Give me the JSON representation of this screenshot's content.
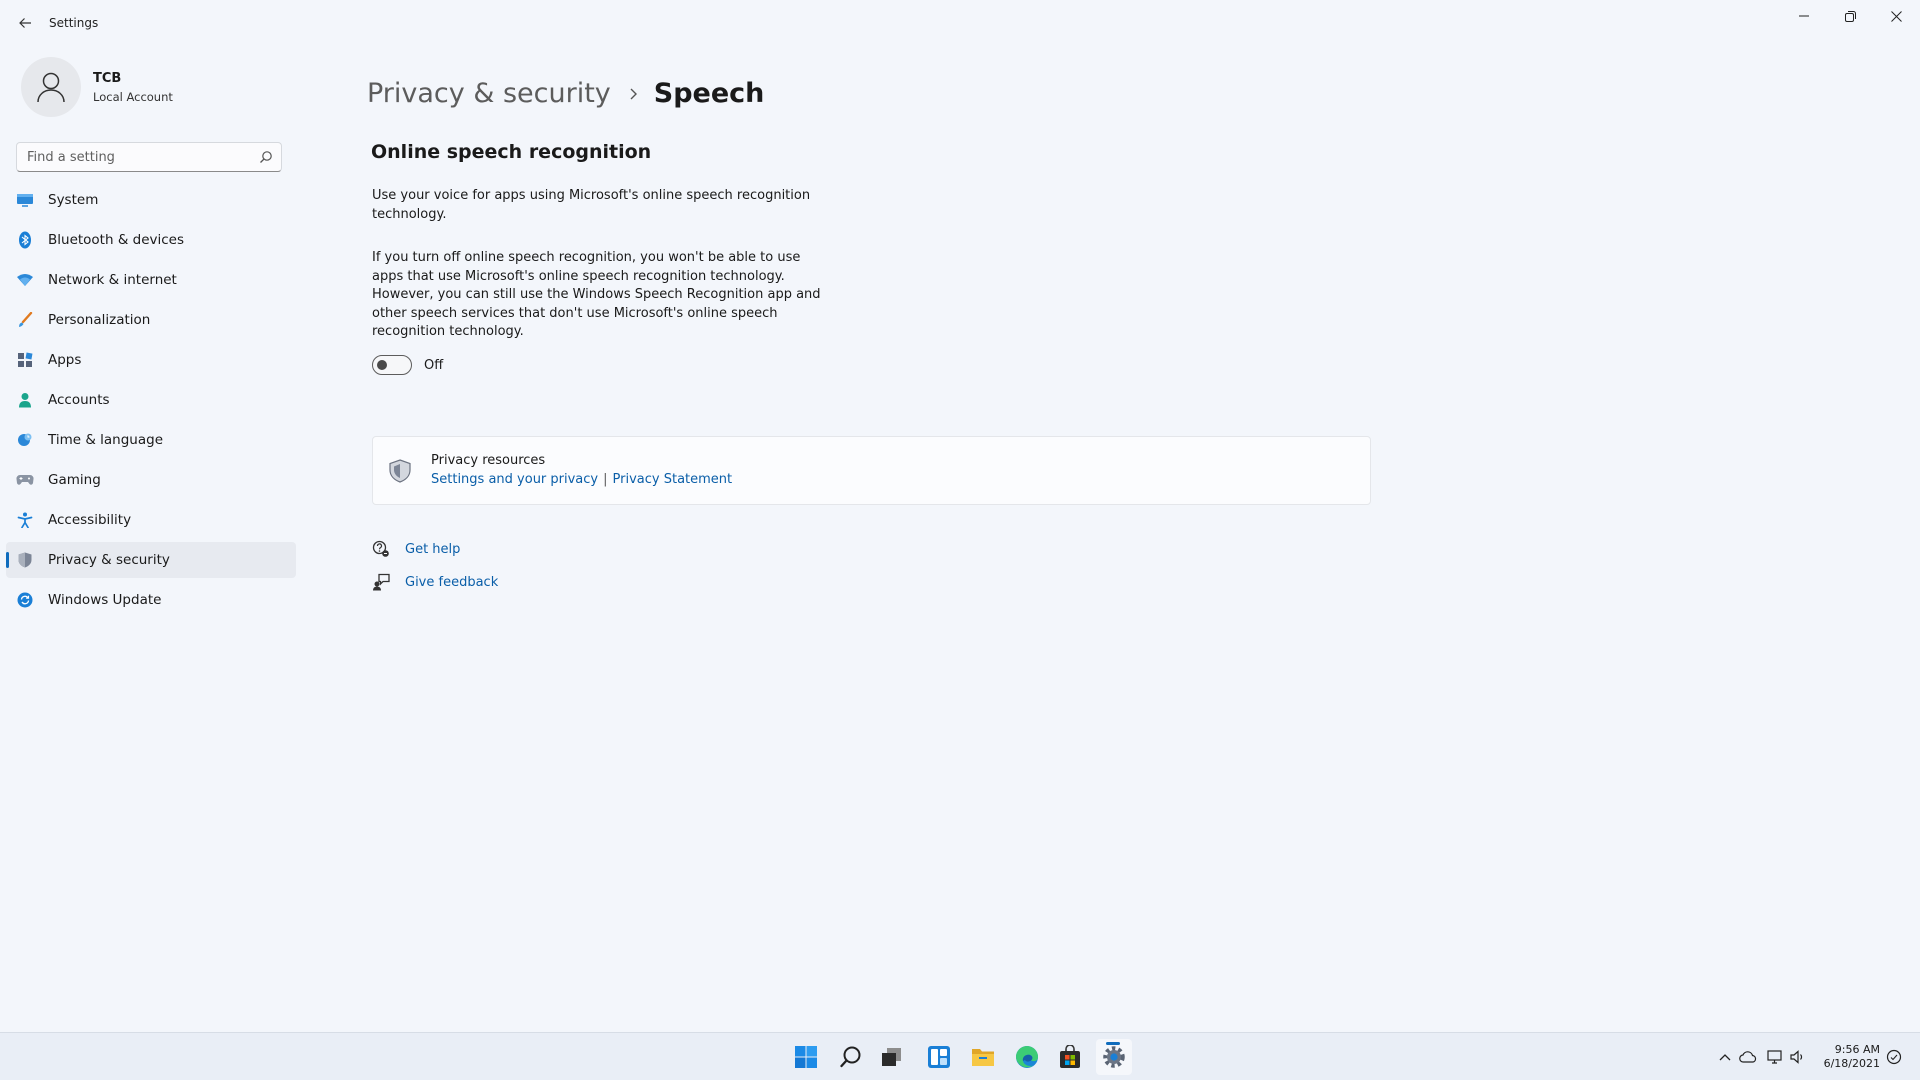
{
  "window": {
    "title": "Settings",
    "controls": [
      "minimize",
      "maximize",
      "close"
    ]
  },
  "user": {
    "name": "TCB",
    "account_type": "Local Account"
  },
  "search": {
    "placeholder": "Find a setting"
  },
  "sidebar": {
    "items": [
      {
        "label": "System",
        "icon": "monitor-icon"
      },
      {
        "label": "Bluetooth & devices",
        "icon": "bluetooth-icon"
      },
      {
        "label": "Network & internet",
        "icon": "wifi-icon"
      },
      {
        "label": "Personalization",
        "icon": "brush-icon"
      },
      {
        "label": "Apps",
        "icon": "apps-icon"
      },
      {
        "label": "Accounts",
        "icon": "person-icon"
      },
      {
        "label": "Time & language",
        "icon": "globe-clock-icon"
      },
      {
        "label": "Gaming",
        "icon": "gamepad-icon"
      },
      {
        "label": "Accessibility",
        "icon": "accessibility-icon"
      },
      {
        "label": "Privacy & security",
        "icon": "shield-icon",
        "active": true
      },
      {
        "label": "Windows Update",
        "icon": "update-icon"
      }
    ]
  },
  "breadcrumb": {
    "parent": "Privacy & security",
    "current": "Speech"
  },
  "section": {
    "title": "Online speech recognition",
    "description1": "Use your voice for apps using Microsoft's online speech recognition technology.",
    "description2": "If you turn off online speech recognition, you won't be able to use apps that use Microsoft's online speech recognition technology.  However, you can still use the Windows Speech Recognition app and other speech services that don't use Microsoft's online speech recognition technology.",
    "toggle": {
      "state": false,
      "label": "Off"
    }
  },
  "privacy_resources": {
    "title": "Privacy resources",
    "link1": "Settings and your privacy",
    "separator": "|",
    "link2": "Privacy Statement"
  },
  "help": {
    "get_help": "Get help",
    "give_feedback": "Give feedback"
  },
  "taskbar": {
    "apps": [
      "start-icon",
      "search-icon",
      "task-view-icon",
      "widgets-icon",
      "file-explorer-icon",
      "edge-icon",
      "store-icon",
      "settings-icon"
    ],
    "active_app": "settings-icon",
    "time": "9:56 AM",
    "date": "6/18/2021"
  },
  "colors": {
    "accent": "#0f6cbd",
    "link": "#0a5ea8",
    "background": "#f3f6fb",
    "taskbar": "#e9eef6"
  }
}
